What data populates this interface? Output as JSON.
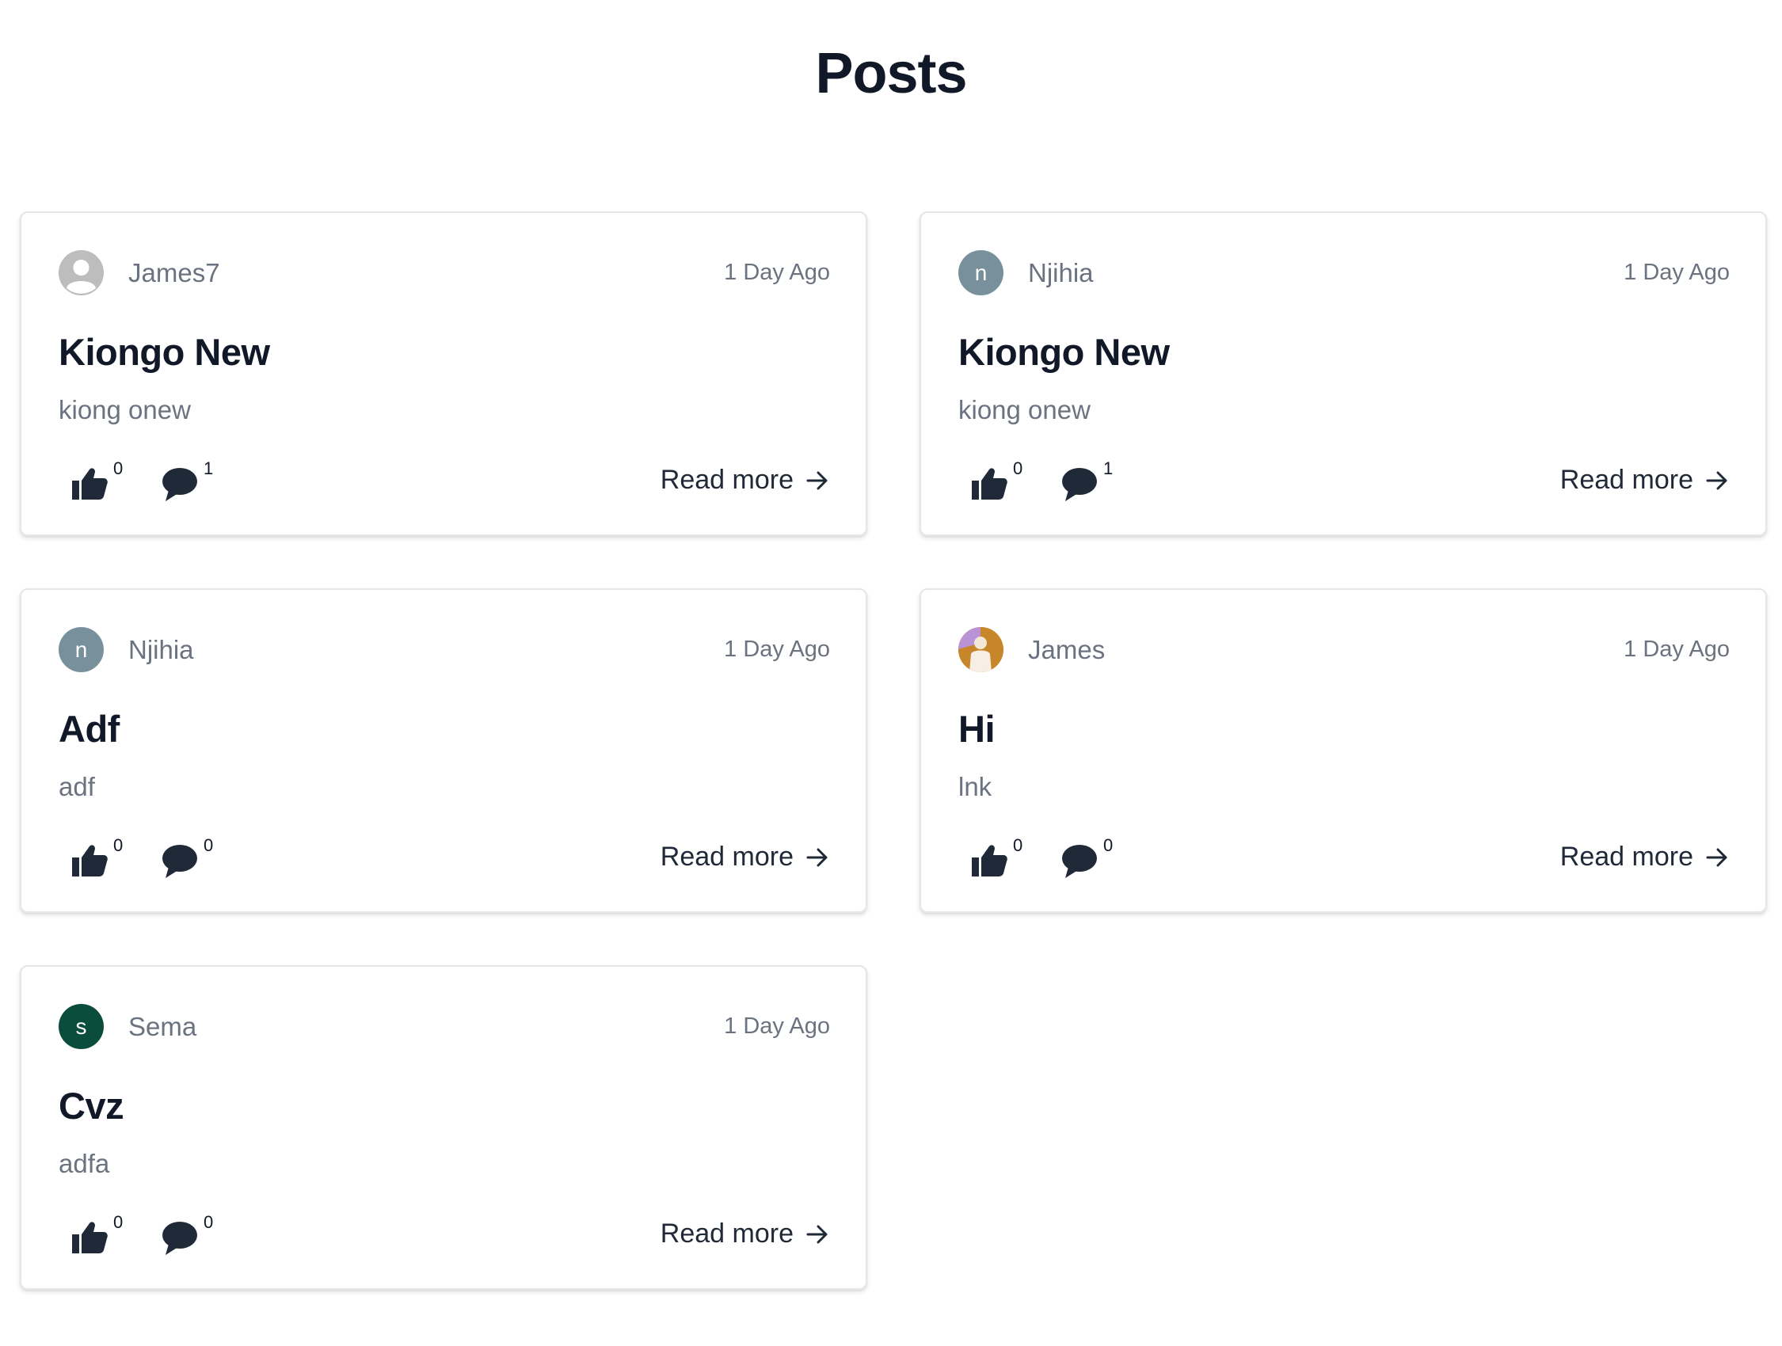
{
  "page": {
    "title": "Posts"
  },
  "colors": {
    "text_primary": "#111827",
    "text_muted": "#6b7280",
    "icon": "#1f2937",
    "avatar_gray": "#78909c",
    "avatar_green": "#0b4d3c"
  },
  "posts": [
    {
      "author": "James7",
      "avatar": {
        "type": "default-user-icon",
        "initial": ""
      },
      "time": "1 Day Ago",
      "title": "Kiongo New",
      "excerpt": "kiong onew",
      "likes": "0",
      "comments": "1",
      "read_more": "Read more"
    },
    {
      "author": "Njihia",
      "avatar": {
        "type": "initial",
        "initial": "n",
        "color": "#78909c"
      },
      "time": "1 Day Ago",
      "title": "Kiongo New",
      "excerpt": "kiong onew",
      "likes": "0",
      "comments": "1",
      "read_more": "Read more"
    },
    {
      "author": "Njihia",
      "avatar": {
        "type": "initial",
        "initial": "n",
        "color": "#78909c"
      },
      "time": "1 Day Ago",
      "title": "Adf",
      "excerpt": "adf",
      "likes": "0",
      "comments": "0",
      "read_more": "Read more"
    },
    {
      "author": "James",
      "avatar": {
        "type": "photo",
        "initial": ""
      },
      "time": "1 Day Ago",
      "title": "Hi",
      "excerpt": "lnk",
      "likes": "0",
      "comments": "0",
      "read_more": "Read more"
    },
    {
      "author": "Sema",
      "avatar": {
        "type": "initial",
        "initial": "s",
        "color": "#0b4d3c"
      },
      "time": "1 Day Ago",
      "title": "Cvz",
      "excerpt": "adfa",
      "likes": "0",
      "comments": "0",
      "read_more": "Read more"
    }
  ]
}
